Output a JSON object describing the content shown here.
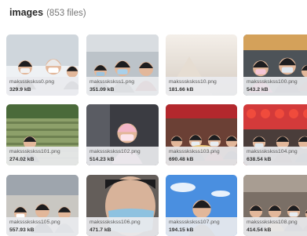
{
  "header": {
    "folder_name": "images",
    "file_count": "(853 files)"
  },
  "files": [
    {
      "name": "makssskskss0.png",
      "size": "329.9 kB",
      "scene": "snow-people"
    },
    {
      "name": "makssskskss1.png",
      "size": "351.09 kB",
      "scene": "masked-crowd"
    },
    {
      "name": "makssskskss10.png",
      "size": "181.66 kB",
      "scene": "bright-light"
    },
    {
      "name": "makssskskss100.png",
      "size": "543.2 kB",
      "scene": "family-selfie"
    },
    {
      "name": "makssskskss101.png",
      "size": "274.02 kB",
      "scene": "garden-field"
    },
    {
      "name": "makssskskss102.png",
      "size": "514.23 kB",
      "scene": "child-pink"
    },
    {
      "name": "makssskskss103.png",
      "size": "690.48 kB",
      "scene": "festive-crowd"
    },
    {
      "name": "makssskskss104.png",
      "size": "638.54 kB",
      "scene": "red-lanterns"
    },
    {
      "name": "makssskskss105.png",
      "size": "557.93 kB",
      "scene": "kids-class"
    },
    {
      "name": "makssskskss106.png",
      "size": "471.7 kB",
      "scene": "closeup-mask"
    },
    {
      "name": "makssskskss107.png",
      "size": "194.15 kB",
      "scene": "blue-sky"
    },
    {
      "name": "makssskskss108.png",
      "size": "414.54 kB",
      "scene": "street-group"
    }
  ]
}
